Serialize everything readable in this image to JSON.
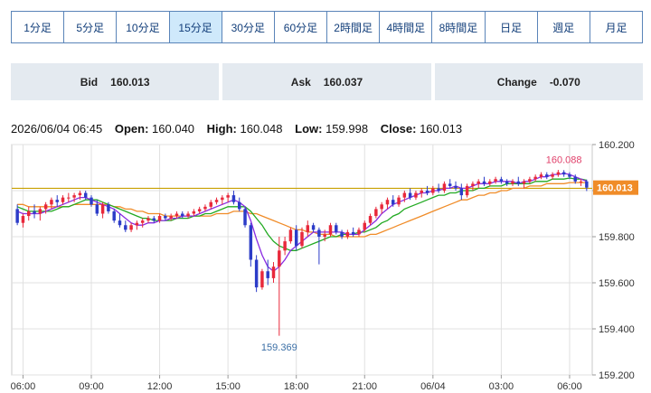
{
  "tabs": [
    {
      "label": "1分足",
      "active": false
    },
    {
      "label": "5分足",
      "active": false
    },
    {
      "label": "10分足",
      "active": false
    },
    {
      "label": "15分足",
      "active": true
    },
    {
      "label": "30分足",
      "active": false
    },
    {
      "label": "60分足",
      "active": false
    },
    {
      "label": "2時間足",
      "active": false
    },
    {
      "label": "4時間足",
      "active": false
    },
    {
      "label": "8時間足",
      "active": false
    },
    {
      "label": "日足",
      "active": false
    },
    {
      "label": "週足",
      "active": false
    },
    {
      "label": "月足",
      "active": false
    }
  ],
  "quotes": {
    "bid_label": "Bid",
    "bid_value": "160.013",
    "ask_label": "Ask",
    "ask_value": "160.037",
    "change_label": "Change",
    "change_value": "-0.070"
  },
  "ohlc": {
    "datetime": "2026/06/04 06:45",
    "open_label": "Open:",
    "open": "160.040",
    "high_label": "High:",
    "high": "160.048",
    "low_label": "Low:",
    "low": "159.998",
    "close_label": "Close:",
    "close": "160.013"
  },
  "colors": {
    "up": "#e8283b",
    "down": "#2c3cc8",
    "ma_short": "#8a2be2",
    "ma_mid": "#22aa22",
    "ma_long": "#f08c28",
    "ref_line": "#c8a000",
    "price_tag": "#f08c28",
    "grid": "#e0e0e0",
    "high_annotation": "#e0406a",
    "low_annotation": "#3a6ea5"
  },
  "chart_data": {
    "type": "candlestick",
    "y_ticks": [
      "160.200",
      "160.000",
      "159.800",
      "159.600",
      "159.400",
      "159.200"
    ],
    "y_tick_values": [
      160.2,
      160.0,
      159.8,
      159.6,
      159.4,
      159.2
    ],
    "ylim": [
      159.2,
      160.2
    ],
    "x_ticks": [
      "06:00",
      "09:00",
      "12:00",
      "15:00",
      "18:00",
      "21:00",
      "06/04",
      "03:00",
      "06:00"
    ],
    "x_tick_index": [
      1,
      13,
      25,
      37,
      49,
      61,
      73,
      85,
      97
    ],
    "reference_line": 160.01,
    "last_price": "160.013",
    "last_price_value": 160.013,
    "annotations": [
      {
        "text": "160.088",
        "index": 96,
        "value": 160.088,
        "kind": "high"
      },
      {
        "text": "159.369",
        "index": 46,
        "value": 159.369,
        "kind": "low"
      }
    ],
    "candles": [
      [
        159.92,
        159.94,
        159.85,
        159.86
      ],
      [
        159.86,
        159.9,
        159.84,
        159.89
      ],
      [
        159.89,
        159.93,
        159.87,
        159.91
      ],
      [
        159.91,
        159.94,
        159.88,
        159.9
      ],
      [
        159.9,
        159.93,
        159.87,
        159.92
      ],
      [
        159.92,
        159.95,
        159.9,
        159.94
      ],
      [
        159.94,
        159.97,
        159.92,
        159.96
      ],
      [
        159.96,
        159.98,
        159.93,
        159.95
      ],
      [
        159.95,
        159.98,
        159.94,
        159.97
      ],
      [
        159.97,
        159.99,
        159.95,
        159.97
      ],
      [
        159.97,
        159.99,
        159.95,
        159.98
      ],
      [
        159.98,
        160.0,
        159.96,
        159.99
      ],
      [
        159.99,
        160.0,
        159.96,
        159.97
      ],
      [
        159.97,
        159.98,
        159.93,
        159.94
      ],
      [
        159.94,
        159.96,
        159.89,
        159.9
      ],
      [
        159.9,
        159.95,
        159.88,
        159.94
      ],
      [
        159.94,
        159.95,
        159.9,
        159.91
      ],
      [
        159.91,
        159.92,
        159.86,
        159.87
      ],
      [
        159.87,
        159.9,
        159.84,
        159.85
      ],
      [
        159.85,
        159.87,
        159.82,
        159.83
      ],
      [
        159.83,
        159.86,
        159.82,
        159.85
      ],
      [
        159.85,
        159.87,
        159.83,
        159.86
      ],
      [
        159.86,
        159.88,
        159.84,
        159.87
      ],
      [
        159.87,
        159.89,
        159.86,
        159.88
      ],
      [
        159.88,
        159.89,
        159.86,
        159.87
      ],
      [
        159.87,
        159.9,
        159.86,
        159.89
      ],
      [
        159.89,
        159.9,
        159.87,
        159.88
      ],
      [
        159.88,
        159.9,
        159.87,
        159.89
      ],
      [
        159.89,
        159.91,
        159.88,
        159.9
      ],
      [
        159.9,
        159.91,
        159.88,
        159.89
      ],
      [
        159.89,
        159.91,
        159.88,
        159.9
      ],
      [
        159.9,
        159.92,
        159.89,
        159.91
      ],
      [
        159.91,
        159.93,
        159.9,
        159.92
      ],
      [
        159.92,
        159.94,
        159.91,
        159.93
      ],
      [
        159.93,
        159.96,
        159.92,
        159.95
      ],
      [
        159.95,
        159.97,
        159.94,
        159.96
      ],
      [
        159.96,
        159.98,
        159.94,
        159.97
      ],
      [
        159.97,
        159.99,
        159.95,
        159.98
      ],
      [
        159.98,
        160.0,
        159.94,
        159.95
      ],
      [
        159.95,
        159.97,
        159.91,
        159.92
      ],
      [
        159.92,
        159.93,
        159.84,
        159.85
      ],
      [
        159.85,
        159.86,
        159.67,
        159.7
      ],
      [
        159.7,
        159.72,
        159.56,
        159.58
      ],
      [
        159.58,
        159.66,
        159.57,
        159.65
      ],
      [
        159.65,
        159.7,
        159.59,
        159.62
      ],
      [
        159.62,
        159.69,
        159.6,
        159.67
      ],
      [
        159.67,
        159.8,
        159.37,
        159.74
      ],
      [
        159.74,
        159.8,
        159.72,
        159.78
      ],
      [
        159.78,
        159.84,
        159.77,
        159.83
      ],
      [
        159.83,
        159.85,
        159.74,
        159.76
      ],
      [
        159.76,
        159.84,
        159.75,
        159.82
      ],
      [
        159.82,
        159.87,
        159.8,
        159.85
      ],
      [
        159.85,
        159.86,
        159.82,
        159.83
      ],
      [
        159.83,
        159.84,
        159.68,
        159.8
      ],
      [
        159.8,
        159.83,
        159.78,
        159.81
      ],
      [
        159.81,
        159.86,
        159.8,
        159.85
      ],
      [
        159.85,
        159.86,
        159.81,
        159.82
      ],
      [
        159.82,
        159.83,
        159.79,
        159.8
      ],
      [
        159.8,
        159.83,
        159.79,
        159.82
      ],
      [
        159.82,
        159.84,
        159.8,
        159.81
      ],
      [
        159.81,
        159.84,
        159.8,
        159.83
      ],
      [
        159.83,
        159.87,
        159.82,
        159.86
      ],
      [
        159.86,
        159.9,
        159.85,
        159.89
      ],
      [
        159.89,
        159.93,
        159.88,
        159.92
      ],
      [
        159.92,
        159.95,
        159.9,
        159.94
      ],
      [
        159.94,
        159.97,
        159.92,
        159.96
      ],
      [
        159.96,
        159.98,
        159.93,
        159.94
      ],
      [
        159.94,
        159.98,
        159.93,
        159.97
      ],
      [
        159.97,
        160.0,
        159.95,
        159.99
      ],
      [
        159.99,
        160.01,
        159.96,
        159.97
      ],
      [
        159.97,
        160.0,
        159.96,
        159.99
      ],
      [
        159.99,
        160.01,
        159.97,
        160.0
      ],
      [
        160.0,
        160.02,
        159.98,
        159.99
      ],
      [
        159.99,
        160.02,
        159.98,
        160.01
      ],
      [
        160.01,
        160.03,
        159.99,
        160.0
      ],
      [
        160.0,
        160.04,
        159.99,
        160.03
      ],
      [
        160.03,
        160.05,
        160.01,
        160.02
      ],
      [
        160.02,
        160.04,
        160.0,
        160.01
      ],
      [
        160.01,
        160.03,
        159.96,
        159.98
      ],
      [
        159.98,
        160.03,
        159.97,
        160.02
      ],
      [
        160.02,
        160.04,
        160.0,
        160.03
      ],
      [
        160.03,
        160.05,
        160.01,
        160.04
      ],
      [
        160.04,
        160.06,
        160.02,
        160.03
      ],
      [
        160.03,
        160.05,
        160.02,
        160.04
      ],
      [
        160.04,
        160.06,
        160.03,
        160.05
      ],
      [
        160.05,
        160.06,
        160.03,
        160.04
      ],
      [
        160.04,
        160.05,
        160.02,
        160.03
      ],
      [
        160.03,
        160.05,
        160.02,
        160.04
      ],
      [
        160.04,
        160.06,
        160.02,
        160.03
      ],
      [
        160.03,
        160.05,
        160.01,
        160.04
      ],
      [
        160.04,
        160.06,
        160.03,
        160.05
      ],
      [
        160.05,
        160.07,
        160.04,
        160.06
      ],
      [
        160.06,
        160.08,
        160.05,
        160.07
      ],
      [
        160.07,
        160.08,
        160.05,
        160.06
      ],
      [
        160.06,
        160.08,
        160.05,
        160.07
      ],
      [
        160.07,
        160.09,
        160.06,
        160.08
      ],
      [
        160.08,
        160.089,
        160.06,
        160.07
      ],
      [
        160.07,
        160.08,
        160.05,
        160.06
      ],
      [
        160.06,
        160.07,
        160.03,
        160.04
      ],
      [
        160.04,
        160.05,
        160.02,
        160.04
      ],
      [
        160.04,
        160.048,
        159.998,
        160.013
      ]
    ],
    "ma_short": [
      159.91,
      159.9,
      159.9,
      159.9,
      159.9,
      159.91,
      159.92,
      159.93,
      159.94,
      159.95,
      159.96,
      159.97,
      159.97,
      159.96,
      159.95,
      159.94,
      159.93,
      159.92,
      159.9,
      159.88,
      159.86,
      159.85,
      159.85,
      159.86,
      159.86,
      159.87,
      159.87,
      159.88,
      159.88,
      159.89,
      159.89,
      159.89,
      159.9,
      159.91,
      159.92,
      159.93,
      159.94,
      159.95,
      159.96,
      159.95,
      159.93,
      159.87,
      159.79,
      159.72,
      159.67,
      159.65,
      159.67,
      159.7,
      159.74,
      159.76,
      159.78,
      159.8,
      159.82,
      159.82,
      159.82,
      159.82,
      159.82,
      159.82,
      159.81,
      159.81,
      159.81,
      159.83,
      159.85,
      159.87,
      159.9,
      159.92,
      159.94,
      159.95,
      159.96,
      159.97,
      159.98,
      159.99,
      159.99,
      160.0,
      160.0,
      160.01,
      160.01,
      160.02,
      160.01,
      160.01,
      160.02,
      160.03,
      160.03,
      160.03,
      160.04,
      160.04,
      160.04,
      160.04,
      160.03,
      160.04,
      160.04,
      160.05,
      160.06,
      160.06,
      160.07,
      160.07,
      160.075,
      160.07,
      160.06,
      160.05,
      160.04
    ],
    "ma_mid": [
      159.93,
      159.92,
      159.91,
      159.91,
      159.91,
      159.91,
      159.91,
      159.92,
      159.93,
      159.93,
      159.94,
      159.95,
      159.96,
      159.96,
      159.96,
      159.95,
      159.94,
      159.93,
      159.92,
      159.91,
      159.9,
      159.89,
      159.88,
      159.88,
      159.87,
      159.87,
      159.87,
      159.87,
      159.88,
      159.88,
      159.88,
      159.89,
      159.89,
      159.9,
      159.9,
      159.91,
      159.92,
      159.93,
      159.93,
      159.93,
      159.93,
      159.91,
      159.88,
      159.85,
      159.81,
      159.78,
      159.76,
      159.75,
      159.74,
      159.74,
      159.75,
      159.76,
      159.77,
      159.78,
      159.79,
      159.8,
      159.8,
      159.81,
      159.81,
      159.81,
      159.82,
      159.82,
      159.83,
      159.84,
      159.86,
      159.87,
      159.89,
      159.9,
      159.92,
      159.93,
      159.94,
      159.95,
      159.96,
      159.97,
      159.98,
      159.98,
      159.99,
      159.99,
      160.0,
      160.0,
      160.0,
      160.01,
      160.01,
      160.02,
      160.02,
      160.02,
      160.03,
      160.03,
      160.03,
      160.03,
      160.03,
      160.04,
      160.04,
      160.04,
      160.05,
      160.05,
      160.05,
      160.055,
      160.05,
      160.05,
      160.045
    ],
    "ma_long": [
      159.94,
      159.94,
      159.93,
      159.93,
      159.93,
      159.93,
      159.93,
      159.93,
      159.93,
      159.93,
      159.94,
      159.94,
      159.94,
      159.94,
      159.94,
      159.94,
      159.94,
      159.93,
      159.93,
      159.92,
      159.92,
      159.91,
      159.91,
      159.9,
      159.9,
      159.9,
      159.89,
      159.89,
      159.89,
      159.89,
      159.89,
      159.89,
      159.89,
      159.89,
      159.89,
      159.9,
      159.9,
      159.9,
      159.91,
      159.91,
      159.91,
      159.9,
      159.9,
      159.89,
      159.88,
      159.87,
      159.86,
      159.85,
      159.84,
      159.83,
      159.83,
      159.82,
      159.82,
      159.81,
      159.81,
      159.81,
      159.8,
      159.8,
      159.8,
      159.8,
      159.8,
      159.8,
      159.81,
      159.81,
      159.82,
      159.83,
      159.84,
      159.85,
      159.86,
      159.87,
      159.88,
      159.89,
      159.9,
      159.91,
      159.92,
      159.93,
      159.94,
      159.95,
      159.96,
      159.96,
      159.97,
      159.98,
      159.98,
      159.99,
      159.99,
      160.0,
      160.0,
      160.01,
      160.01,
      160.01,
      160.02,
      160.02,
      160.02,
      160.03,
      160.03,
      160.03,
      160.03,
      160.035,
      160.035,
      160.035,
      160.035
    ]
  }
}
